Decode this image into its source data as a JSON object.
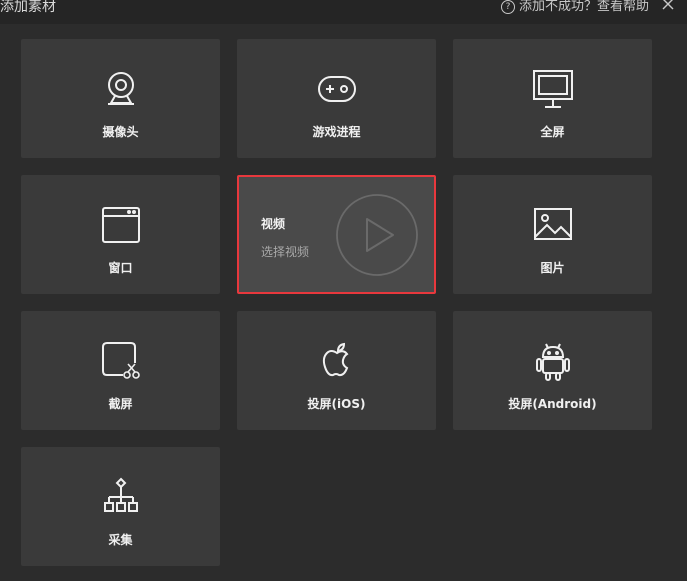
{
  "header": {
    "title": "添加素材",
    "help_icon": "?",
    "help_text": "添加不成功？查看帮助",
    "close_icon": "close-icon"
  },
  "tiles": [
    {
      "label": "摄像头",
      "icon": "webcam-icon"
    },
    {
      "label": "游戏进程",
      "icon": "gamepad-icon"
    },
    {
      "label": "全屏",
      "icon": "monitor-icon"
    },
    {
      "label": "窗口",
      "icon": "window-icon"
    },
    {
      "label": "视频",
      "sub_label": "选择视频",
      "icon": "play-icon",
      "selected": true
    },
    {
      "label": "图片",
      "icon": "image-icon"
    },
    {
      "label": "截屏",
      "icon": "screenshot-icon"
    },
    {
      "label": "投屏(iOS)",
      "icon": "apple-icon"
    },
    {
      "label": "投屏(Android)",
      "icon": "android-icon"
    },
    {
      "label": "采集",
      "icon": "capture-hierarchy-icon"
    }
  ],
  "colors": {
    "background": "#2c2c2c",
    "tile": "#3a3a3a",
    "selected_border": "#e8383d"
  }
}
